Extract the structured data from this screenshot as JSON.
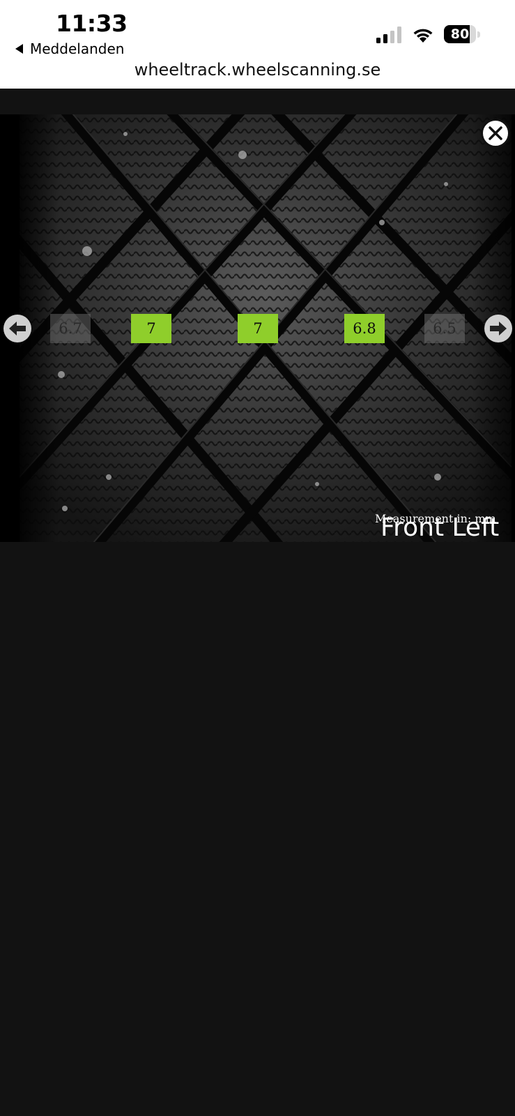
{
  "status_bar": {
    "time": "11:33",
    "back_label": "Meddelanden",
    "battery_percent": "80",
    "battery_level": 0.8,
    "signal_bars_active": 2,
    "signal_bars_total": 4
  },
  "browser": {
    "url": "wheeltrack.wheelscanning.se"
  },
  "viewer": {
    "measurements": [
      {
        "value": "6.7",
        "state": "dim"
      },
      {
        "value": "7",
        "state": "ok"
      },
      {
        "value": "7",
        "state": "ok"
      },
      {
        "value": "6.8",
        "state": "ok"
      },
      {
        "value": "6.5",
        "state": "dim"
      }
    ],
    "measurement_unit_note": "Measurement in: mm",
    "wheel_position": "Front Left",
    "colors": {
      "ok": "#8fce2b",
      "dim": "#787878",
      "background": "#121212"
    },
    "icons": {
      "close": "close-circle-icon",
      "prev": "arrow-left-icon",
      "next": "arrow-right-icon"
    }
  }
}
